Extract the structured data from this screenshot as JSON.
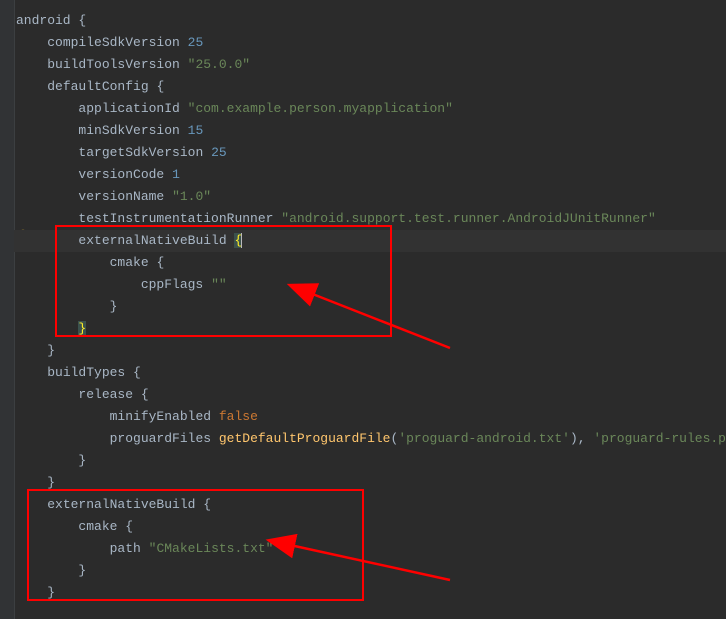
{
  "code": {
    "l1": "android",
    "l2": "compileSdkVersion",
    "l2n": "25",
    "l3": "buildToolsVersion",
    "l3s": "\"25.0.0\"",
    "l4": "defaultConfig",
    "l5": "applicationId",
    "l5s": "\"com.example.person.myapplication\"",
    "l6": "minSdkVersion",
    "l6n": "15",
    "l7": "targetSdkVersion",
    "l7n": "25",
    "l8": "versionCode",
    "l8n": "1",
    "l9": "versionName",
    "l9s": "\"1.0\"",
    "l10": "testInstrumentationRunner",
    "l10s": "\"android.support.test.runner.AndroidJUnitRunner\"",
    "l11": "externalNativeBuild",
    "l12": "cmake",
    "l13": "cppFlags",
    "l13s": "\"\"",
    "l17": "buildTypes",
    "l18": "release",
    "l19": "minifyEnabled",
    "l19k": "false",
    "l20": "proguardFiles",
    "l20f": "getDefaultProguardFile",
    "l20s1": "'proguard-android.txt'",
    "l20s2": "'proguard-rules.pro'",
    "l23": "externalNativeBuild",
    "l24": "cmake",
    "l25": "path",
    "l25s": "\"CMakeLists.txt\""
  }
}
